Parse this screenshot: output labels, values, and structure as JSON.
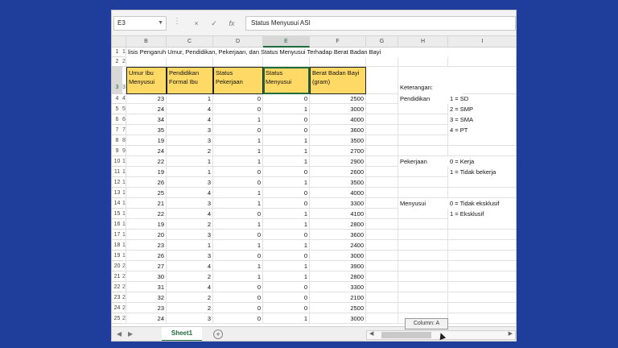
{
  "formula_bar": {
    "name_box": "E3",
    "fx": "fx",
    "cancel": "×",
    "confirm": "✓",
    "formula": "Status Menyusui ASI"
  },
  "columns": [
    "B",
    "C",
    "D",
    "E",
    "F",
    "G",
    "H",
    "I"
  ],
  "selected_column": "E",
  "title": "lisis Pengaruh Umur, Pendidikan, Pekerjaan, dan Status Menyusui Terhadap Berat Badan Bayi",
  "headers": {
    "b": "Umur Ibu Menyusui",
    "c": "Pendidikan Formal Ibu",
    "d": "Status Pekerjaan",
    "e": "Status Menyusui",
    "f": "Berat Badan Bayi (gram)"
  },
  "row_headers": [
    "1",
    "2",
    "3",
    "4",
    "5",
    "6",
    "7",
    "8",
    "9",
    "10",
    "11",
    "12",
    "13",
    "14",
    "15",
    "16",
    "17",
    "18",
    "19",
    "20",
    "21",
    "22",
    "23",
    "24",
    "25"
  ],
  "col_a_fragments": [
    "1",
    "2",
    "3",
    "4",
    "5",
    "6",
    "7",
    "8",
    "9",
    "10",
    "11",
    "12",
    "13",
    "14",
    "15",
    "16",
    "17",
    "18",
    "19",
    "20",
    "21",
    "22",
    "23",
    "24",
    "25"
  ],
  "rows": [
    [
      "23",
      "1",
      "0",
      "0",
      "2500"
    ],
    [
      "24",
      "4",
      "0",
      "1",
      "3000"
    ],
    [
      "34",
      "4",
      "1",
      "0",
      "4000"
    ],
    [
      "35",
      "3",
      "0",
      "0",
      "3600"
    ],
    [
      "19",
      "3",
      "1",
      "1",
      "3500"
    ],
    [
      "24",
      "2",
      "1",
      "1",
      "2700"
    ],
    [
      "22",
      "1",
      "1",
      "1",
      "2900"
    ],
    [
      "19",
      "1",
      "0",
      "0",
      "2600"
    ],
    [
      "26",
      "3",
      "0",
      "1",
      "3500"
    ],
    [
      "25",
      "4",
      "1",
      "0",
      "4000"
    ],
    [
      "21",
      "3",
      "1",
      "0",
      "3300"
    ],
    [
      "22",
      "4",
      "0",
      "1",
      "4100"
    ],
    [
      "19",
      "2",
      "1",
      "1",
      "2800"
    ],
    [
      "20",
      "3",
      "0",
      "0",
      "3600"
    ],
    [
      "23",
      "1",
      "1",
      "1",
      "2400"
    ],
    [
      "26",
      "3",
      "0",
      "0",
      "3000"
    ],
    [
      "27",
      "4",
      "1",
      "1",
      "3900"
    ],
    [
      "30",
      "2",
      "1",
      "1",
      "2800"
    ],
    [
      "31",
      "4",
      "0",
      "0",
      "3300"
    ],
    [
      "32",
      "2",
      "0",
      "0",
      "2100"
    ],
    [
      "23",
      "2",
      "0",
      "0",
      "2500"
    ],
    [
      "24",
      "3",
      "0",
      "1",
      "3000"
    ]
  ],
  "legend": {
    "keterangan": "Keterangan:",
    "pendidikan": "Pendidikan",
    "pendidikan_items": [
      "1 = SD",
      "2 = SMP",
      "3 = SMA",
      "4 = PT"
    ],
    "pekerjaan": "Pekerjaan",
    "pekerjaan_items": [
      "0 = Kerja",
      "1 = Tidak bekerja"
    ],
    "menyusui": "Menyusui",
    "menyusui_items": [
      "0 = Tidak eksklusif",
      "1 = Eksklusif"
    ]
  },
  "tabs": {
    "sheet1": "Sheet1",
    "add": "+",
    "nav_prev": "◀",
    "nav_next": "▶"
  },
  "tooltip": "Column: A"
}
